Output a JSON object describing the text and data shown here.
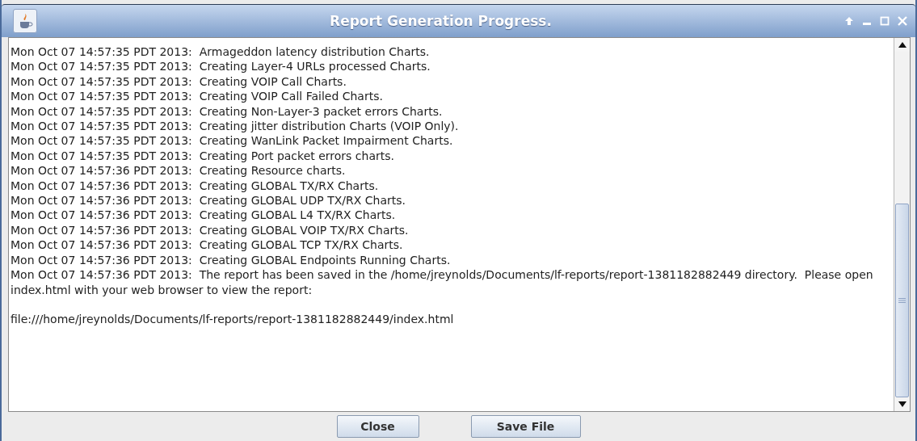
{
  "window": {
    "title": "Report Generation Progress."
  },
  "log": {
    "lines": [
      "Mon Oct 07 14:57:35 PDT 2013:  Armageddon latency distribution Charts.",
      "Mon Oct 07 14:57:35 PDT 2013:  Creating Layer-4 URLs processed Charts.",
      "Mon Oct 07 14:57:35 PDT 2013:  Creating VOIP Call Charts.",
      "Mon Oct 07 14:57:35 PDT 2013:  Creating VOIP Call Failed Charts.",
      "Mon Oct 07 14:57:35 PDT 2013:  Creating Non-Layer-3 packet errors Charts.",
      "Mon Oct 07 14:57:35 PDT 2013:  Creating jitter distribution Charts (VOIP Only).",
      "Mon Oct 07 14:57:35 PDT 2013:  Creating WanLink Packet Impairment Charts.",
      "Mon Oct 07 14:57:35 PDT 2013:  Creating Port packet errors charts.",
      "Mon Oct 07 14:57:36 PDT 2013:  Creating Resource charts.",
      "Mon Oct 07 14:57:36 PDT 2013:  Creating GLOBAL TX/RX Charts.",
      "Mon Oct 07 14:57:36 PDT 2013:  Creating GLOBAL UDP TX/RX Charts.",
      "Mon Oct 07 14:57:36 PDT 2013:  Creating GLOBAL L4 TX/RX Charts.",
      "Mon Oct 07 14:57:36 PDT 2013:  Creating GLOBAL VOIP TX/RX Charts.",
      "Mon Oct 07 14:57:36 PDT 2013:  Creating GLOBAL TCP TX/RX Charts.",
      "Mon Oct 07 14:57:36 PDT 2013:  Creating GLOBAL Endpoints Running Charts.",
      "Mon Oct 07 14:57:36 PDT 2013:  The report has been saved in the /home/jreynolds/Documents/lf-reports/report-1381182882449 directory.  Please open index.html with your web browser to view the report:",
      "file:///home/jreynolds/Documents/lf-reports/report-1381182882449/index.html"
    ]
  },
  "buttons": [
    "Close",
    "Save File"
  ]
}
